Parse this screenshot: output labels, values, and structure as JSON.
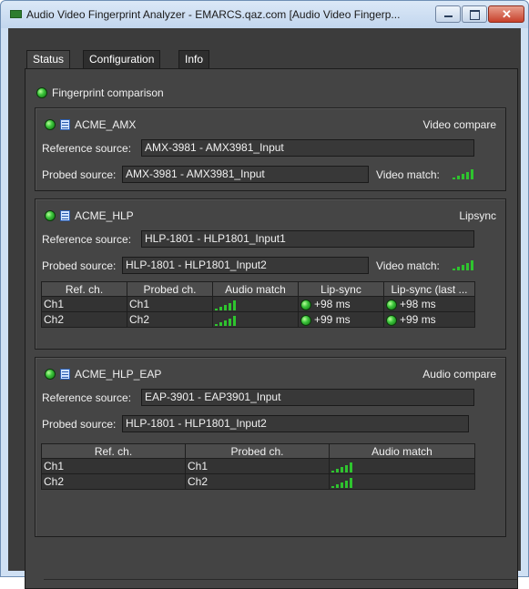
{
  "window": {
    "title": "Audio Video Fingerprint Analyzer - EMARCS.qaz.com [Audio Video Fingerp...",
    "app_icon": "green-rect-icon"
  },
  "tabs": [
    {
      "label": "Status",
      "active": true
    },
    {
      "label": "Configuration",
      "active": false
    },
    {
      "label": "Info",
      "active": false
    }
  ],
  "fingerprint": {
    "label": "Fingerprint comparison"
  },
  "labels": {
    "reference_source": "Reference source:",
    "probed_source": "Probed source:",
    "video_match": "Video match:"
  },
  "groups": [
    {
      "name": "ACME_AMX",
      "mode": "Video compare",
      "reference": "AMX-3981 - AMX3981_Input",
      "probed": "AMX-3981 - AMX3981_Input",
      "video_match_level": 1.0
    },
    {
      "name": "ACME_HLP",
      "mode": "Lipsync",
      "reference": "HLP-1801 - HLP1801_Input1",
      "probed": "HLP-1801 - HLP1801_Input2",
      "video_match_level": 1.0,
      "table": {
        "headers": [
          "Ref. ch.",
          "Probed ch.",
          "Audio match",
          "Lip-sync",
          "Lip-sync (last ..."
        ],
        "rows": [
          {
            "ref": "Ch1",
            "probed": "Ch1",
            "audio_level": 1.0,
            "lipsync": "+98 ms",
            "lipsync_last": "+98 ms"
          },
          {
            "ref": "Ch2",
            "probed": "Ch2",
            "audio_level": 1.0,
            "lipsync": "+99 ms",
            "lipsync_last": "+99 ms"
          }
        ]
      }
    },
    {
      "name": "ACME_HLP_EAP",
      "mode": "Audio compare",
      "reference": "EAP-3901 - EAP3901_Input",
      "probed": "HLP-1801 - HLP1801_Input2",
      "table": {
        "headers": [
          "Ref. ch.",
          "Probed ch.",
          "Audio match"
        ],
        "rows": [
          {
            "ref": "Ch1",
            "probed": "Ch1",
            "audio_level": 1.0
          },
          {
            "ref": "Ch2",
            "probed": "Ch2",
            "audio_level": 1.0
          }
        ]
      }
    }
  ],
  "colors": {
    "led": "#3cc43c",
    "meter": "#2ec42e",
    "panel": "#444444"
  }
}
